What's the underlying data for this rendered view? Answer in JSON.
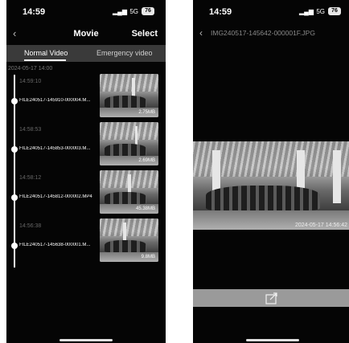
{
  "left_screen": {
    "status": {
      "time": "14:59",
      "network": "5G",
      "battery": "76"
    },
    "nav": {
      "back_icon": "chevron-left-icon",
      "title": "Movie",
      "select": "Select"
    },
    "tabs": [
      "Normal Video",
      "Emergency video"
    ],
    "date_header": "2024-05-17 14:00",
    "clips": [
      {
        "time": "14:59:10",
        "file": "FILE240517-145910-000004.M...",
        "size": "2.75MB"
      },
      {
        "time": "14:58:53",
        "file": "FILE240517-145853-000003.M...",
        "size": "2.69MB"
      },
      {
        "time": "14:58:12",
        "file": "FILE240517-145812-000002.MP4",
        "size": "45.38MB"
      },
      {
        "time": "14:56:38",
        "file": "FILE240517-145638-000001.M...",
        "size": "9.8MB"
      }
    ]
  },
  "right_screen": {
    "status": {
      "time": "14:59",
      "network": "5G",
      "battery": "76"
    },
    "nav": {
      "back_icon": "chevron-left-icon",
      "title": "IMG240517-145642-000001F.JPG"
    },
    "photo_timestamp": "2024-05-17 14:56:42",
    "action_icon": "share-icon"
  }
}
